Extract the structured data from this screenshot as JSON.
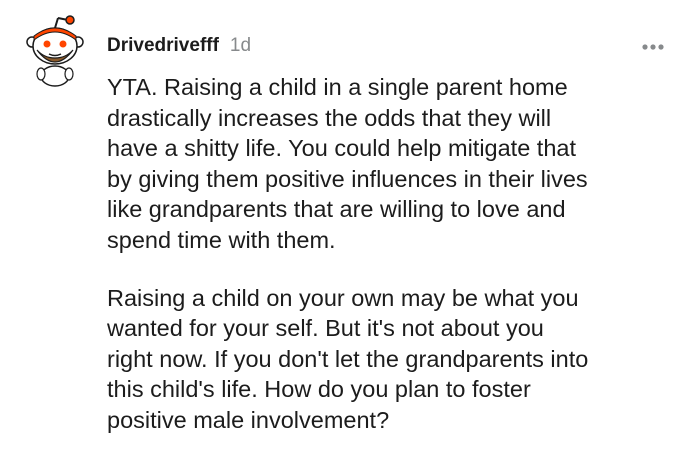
{
  "comment": {
    "author": "Drivedrivefff",
    "age": "1d",
    "more_icon": "ellipsis-icon",
    "avatar_icon": "snoo-avatar-icon",
    "paragraphs": [
      "YTA. Raising a child in a single parent home\ndrastically increases the odds that they will\nhave a shitty life. You could help mitigate that\nby giving them positive influences in their lives\nlike grandparents that are willing to love and\nspend time with them.",
      "Raising a child on your own may be what you\nwanted for your self. But it's not about you\nright now. If you don't let the grandparents into\nthis child's life. How do you plan to foster\npositive male involvement?"
    ]
  },
  "colors": {
    "text": "#1c1c1c",
    "meta": "#878a8c",
    "avatar_accent": "#ff4500"
  }
}
